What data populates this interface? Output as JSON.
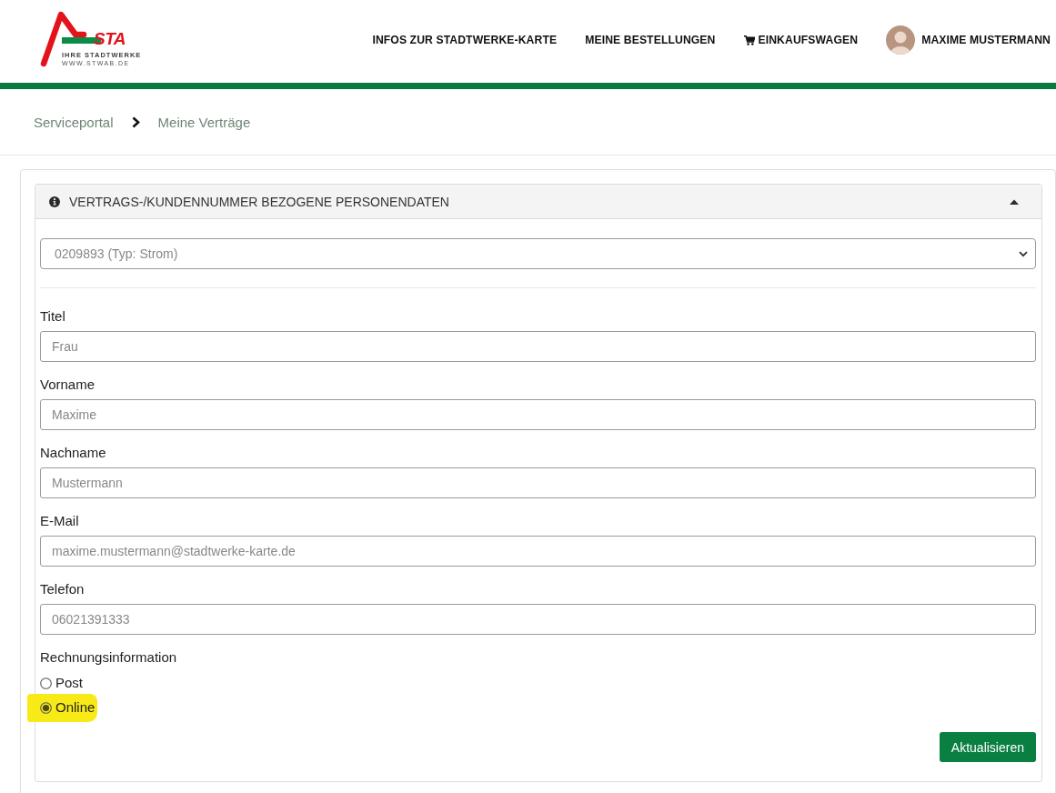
{
  "header": {
    "logo": {
      "wordmark": "STA",
      "tagline": "IHRE STADTWERKE",
      "url": "WWW.STWAB.DE"
    },
    "nav": [
      {
        "label": "INFOS ZUR STADTWERKE-KARTE",
        "kind": "link"
      },
      {
        "label": "MEINE BESTELLUNGEN",
        "kind": "link"
      },
      {
        "label": "EINKAUFSWAGEN",
        "kind": "cart"
      },
      {
        "label": "MAXIME MUSTERMANN",
        "kind": "user"
      }
    ]
  },
  "breadcrumb": [
    "Serviceportal",
    "Meine Verträge"
  ],
  "panel": {
    "title": "VERTRAGS-/KUNDENNUMMER BEZOGENE PERSONENDATEN",
    "expanded": true,
    "contract_select": {
      "value": "0209893 (Typ: Strom)"
    },
    "fields": [
      {
        "label": "Titel",
        "value": "Frau"
      },
      {
        "label": "Vorname",
        "value": "Maxime"
      },
      {
        "label": "Nachname",
        "value": "Mustermann"
      },
      {
        "label": "E-Mail",
        "value": "maxime.mustermann@stadtwerke-karte.de"
      },
      {
        "label": "Telefon",
        "value": "06021391333"
      }
    ],
    "billing": {
      "label": "Rechnungsinformation",
      "options": [
        {
          "label": "Post",
          "selected": false,
          "highlighted": false
        },
        {
          "label": "Online",
          "selected": true,
          "highlighted": true
        }
      ]
    },
    "button": "Aktualisieren"
  }
}
